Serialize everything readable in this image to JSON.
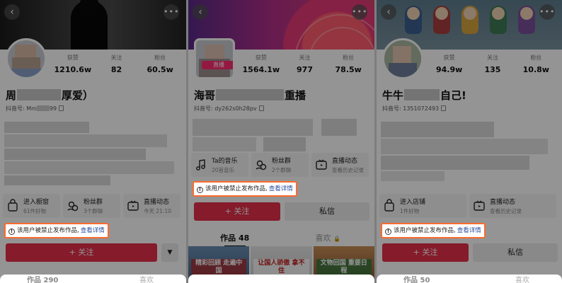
{
  "panels": [
    {
      "stats": [
        {
          "label": "获赞",
          "value": "1210.6w"
        },
        {
          "label": "关注",
          "value": "82"
        },
        {
          "label": "粉丝",
          "value": "60.5w"
        }
      ],
      "name_prefix": "周",
      "name_suffix": "厚爱）",
      "uid": "抖音号: Mm",
      "uid_suffix": "99",
      "tools": [
        {
          "title": "进入橱窗",
          "sub": "61件好物",
          "icon": "shopping-bag-icon"
        },
        {
          "title": "粉丝群",
          "sub": "3个群聊",
          "icon": "group-icon"
        },
        {
          "title": "直播动态",
          "sub": "今天 21:10",
          "icon": "live-tv-icon"
        }
      ],
      "ban_text": "该用户被禁止发布作品,",
      "ban_link": "查看详情",
      "follow": "+ 关注",
      "dropdown": "▼",
      "bottom_left": "作品 290",
      "bottom_right": "喜欢"
    },
    {
      "stats": [
        {
          "label": "获赞",
          "value": "1564.1w"
        },
        {
          "label": "关注",
          "value": "977"
        },
        {
          "label": "粉丝",
          "value": "78.5w"
        }
      ],
      "live_tag": "直播",
      "name_prefix": "海哥",
      "name_suffix": "重播",
      "uid": "抖音号: dy262s0h28pv",
      "tools": [
        {
          "title": "Ta的音乐",
          "sub": "20首音乐",
          "icon": "music-note-icon"
        },
        {
          "title": "粉丝群",
          "sub": "2个群聊",
          "icon": "group-icon"
        },
        {
          "title": "直播动态",
          "sub": "查看历史记录",
          "icon": "live-tv-icon"
        }
      ],
      "ban_text": "该用户被禁止发布作品,",
      "ban_link": "查看详情",
      "follow": "+ 关注",
      "message": "私信",
      "tab_works": "作品 48",
      "tab_likes": "喜欢",
      "thumbs": [
        "精彩回顾 走遍中国",
        "让国人骄傲 拿不住",
        "文物回国 重要日程"
      ]
    },
    {
      "stats": [
        {
          "label": "获赞",
          "value": "94.9w"
        },
        {
          "label": "关注",
          "value": "135"
        },
        {
          "label": "粉丝",
          "value": "10.8w"
        }
      ],
      "name_prefix": "牛牛",
      "name_suffix": "自己!",
      "uid": "抖音号: 1351072493",
      "tools": [
        {
          "title": "进入店铺",
          "sub": "1件好物",
          "icon": "shopping-bag-icon"
        },
        {
          "title": "直播动态",
          "sub": "查看历史记录",
          "icon": "live-tv-icon"
        }
      ],
      "ban_text": "该用户被禁止发布作品,",
      "ban_link": "查看详情",
      "follow": "+ 关注",
      "message": "私信",
      "bottom_left": "作品 50",
      "bottom_right": "喜欢"
    }
  ],
  "colors": {
    "accent": "#e5304a",
    "highlight_border": "#ff6a2c",
    "link": "#2a4f9e"
  }
}
